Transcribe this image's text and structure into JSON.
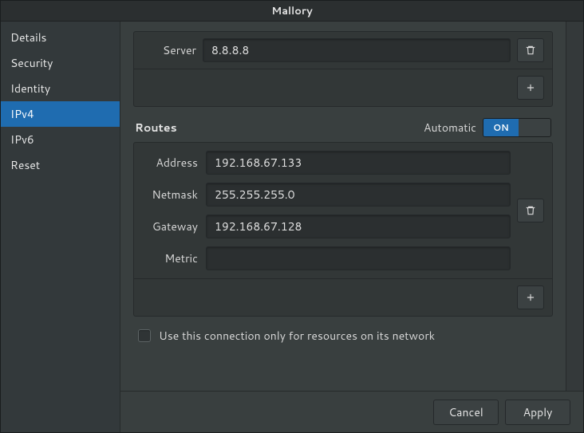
{
  "window": {
    "title": "Mallory"
  },
  "sidebar": {
    "items": [
      {
        "label": "Details"
      },
      {
        "label": "Security"
      },
      {
        "label": "Identity"
      },
      {
        "label": "IPv4"
      },
      {
        "label": "IPv6"
      },
      {
        "label": "Reset"
      }
    ],
    "selected_index": 3
  },
  "dns": {
    "server_label": "Server",
    "server_value": "8.8.8.8"
  },
  "routes": {
    "title": "Routes",
    "automatic_label": "Automatic",
    "automatic_on_text": "ON",
    "automatic_state": true,
    "fields": {
      "address_label": "Address",
      "address_value": "192.168.67.133",
      "netmask_label": "Netmask",
      "netmask_value": "255.255.255.0",
      "gateway_label": "Gateway",
      "gateway_value": "192.168.67.128",
      "metric_label": "Metric",
      "metric_value": ""
    }
  },
  "only_local": {
    "label": "Use this connection only for resources on its network",
    "checked": false
  },
  "footer": {
    "cancel": "Cancel",
    "apply": "Apply"
  },
  "icons": {
    "trash": "trash-icon",
    "plus": "plus-icon"
  }
}
